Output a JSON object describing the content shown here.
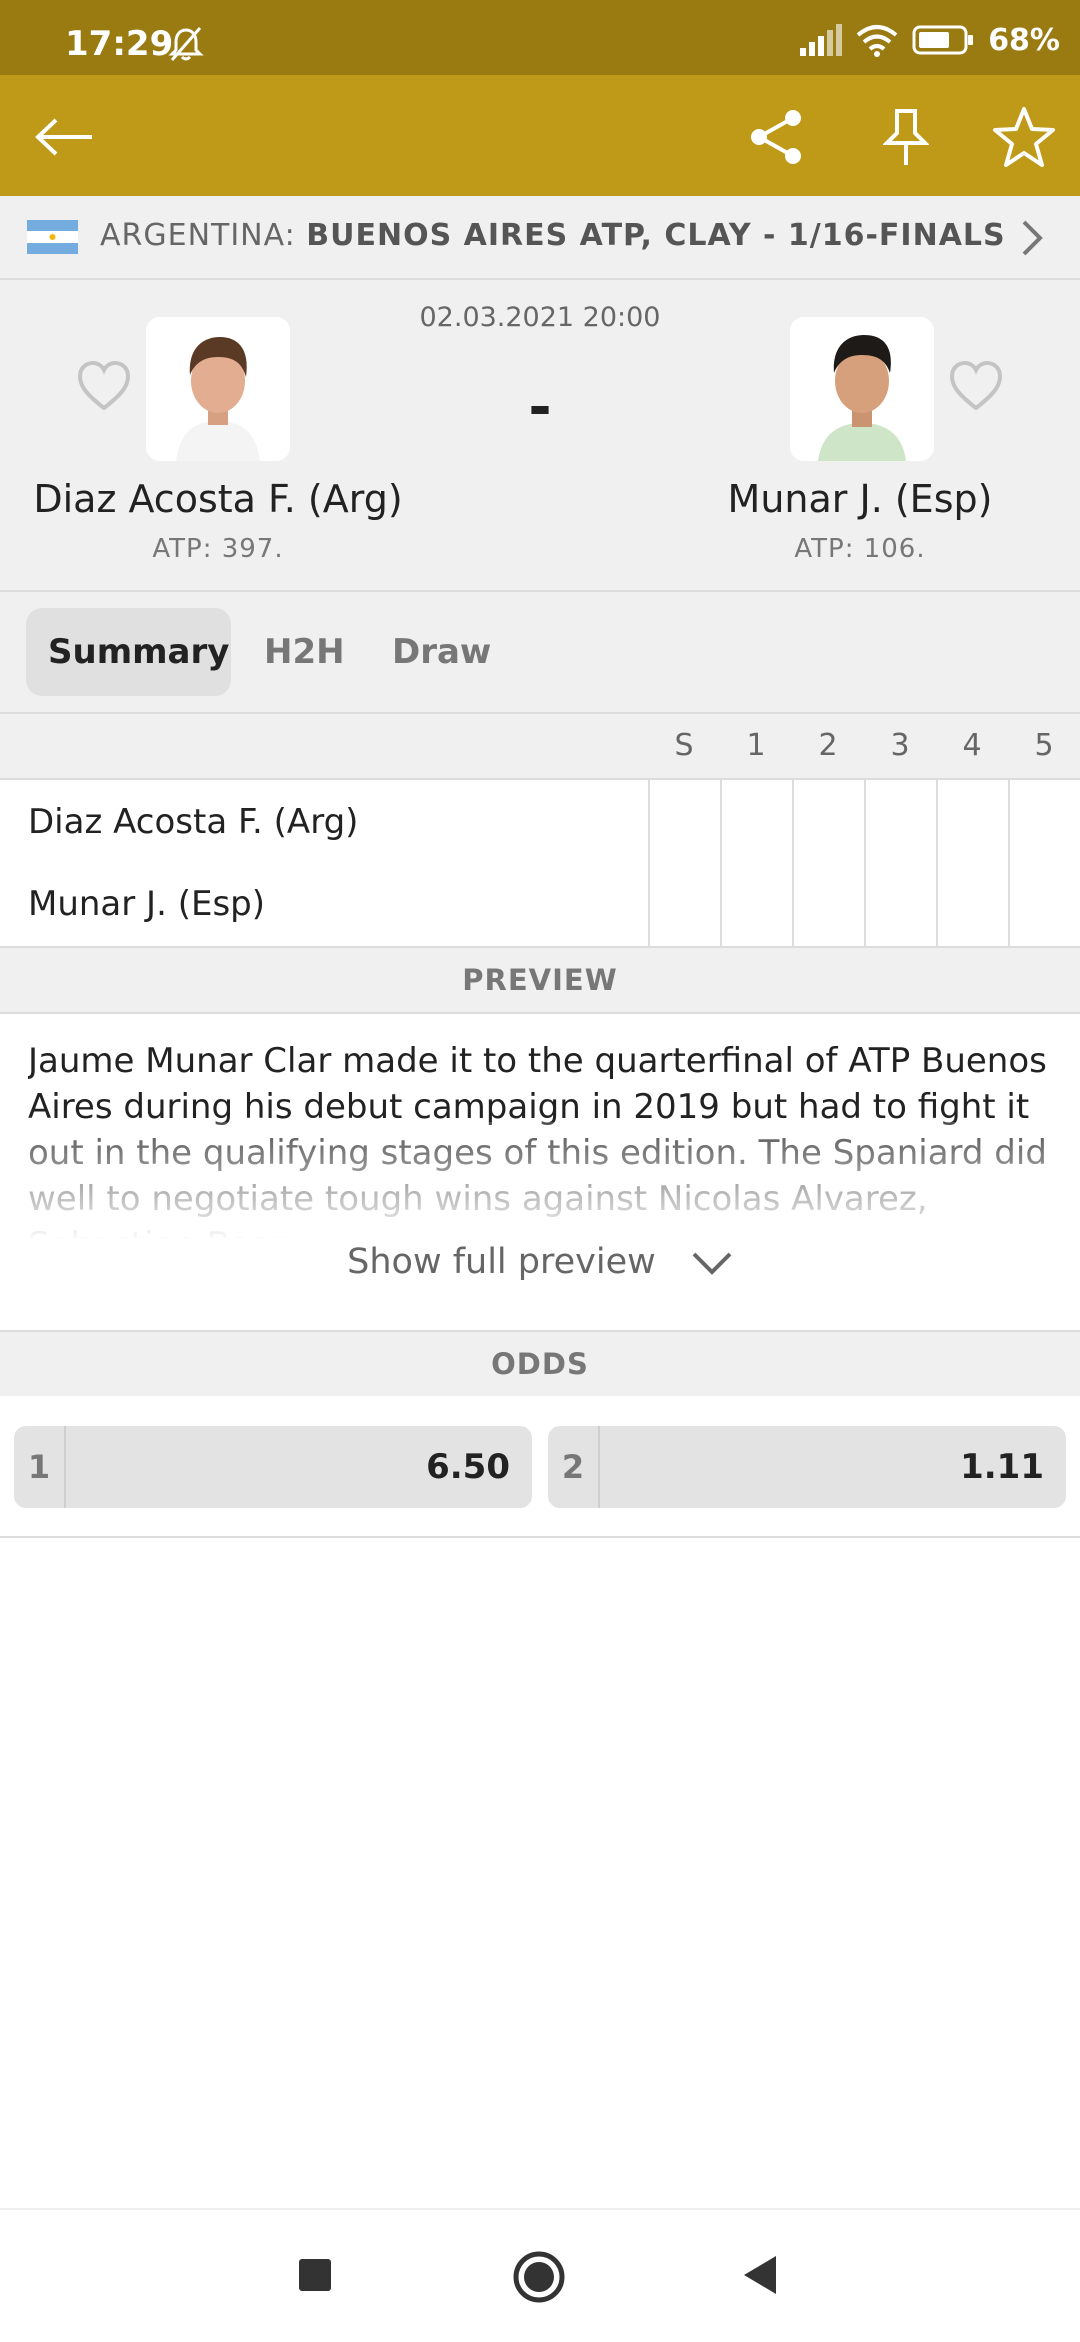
{
  "status_bar": {
    "time": "17:29",
    "battery": "68%"
  },
  "tournament": {
    "country": "ARGENTINA:",
    "name": "BUENOS AIRES ATP, CLAY - 1/16-FINALS"
  },
  "match": {
    "datetime": "02.03.2021 20:00",
    "score": "-",
    "home": {
      "name": "Diaz Acosta F. (Arg)",
      "rank": "ATP: 397."
    },
    "away": {
      "name": "Munar J. (Esp)",
      "rank": "ATP: 106."
    }
  },
  "tabs": [
    "Summary",
    "H2H",
    "Draw"
  ],
  "scoreboard": {
    "columns": [
      "S",
      "1",
      "2",
      "3",
      "4",
      "5"
    ],
    "rows": [
      "Diaz Acosta F. (Arg)",
      "Munar J. (Esp)"
    ]
  },
  "preview": {
    "heading": "PREVIEW",
    "text": "Jaume Munar Clar made it to the quarterfinal of ATP Buenos Aires during his debut campaign in 2019 but had to fight it out in the qualifying stages of this edition. The Spaniard did well to negotiate tough wins against Nicolas Alvarez, Sebastian Baez",
    "show_full": "Show full preview"
  },
  "odds": {
    "heading": "ODDS",
    "items": [
      {
        "label": "1",
        "value": "6.50"
      },
      {
        "label": "2",
        "value": "1.11"
      }
    ]
  },
  "colors": {
    "status_bar": "#9a7b12",
    "app_bar": "#bf9a18",
    "panel": "#f0f0f0"
  },
  "icons": {
    "app_bar": [
      "back-arrow-icon",
      "share-icon",
      "pin-icon",
      "star-icon"
    ],
    "nav_bar": [
      "recents-icon",
      "home-icon",
      "back-icon"
    ]
  }
}
